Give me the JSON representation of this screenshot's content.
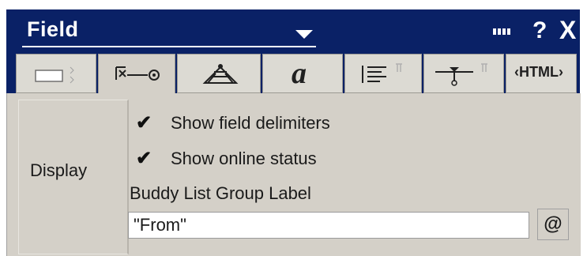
{
  "window": {
    "title": "Field",
    "help_label": "?",
    "close_label": "X"
  },
  "tabs": [
    {
      "name": "field-info",
      "icon": "field-box-icon"
    },
    {
      "name": "field-control",
      "icon": "field-key-icon",
      "active": true
    },
    {
      "name": "hide-when",
      "icon": "hat-icon"
    },
    {
      "name": "font",
      "icon": "font-a-icon",
      "label": "a"
    },
    {
      "name": "paragraph",
      "icon": "paragraph-align-icon"
    },
    {
      "name": "paragraph-hide",
      "icon": "paragraph-hide-icon"
    },
    {
      "name": "html",
      "icon": "html-tag-icon",
      "label": "‹HTML›"
    }
  ],
  "panel": {
    "section_label": "Display",
    "options": [
      {
        "label": "Show field delimiters",
        "checked": true
      },
      {
        "label": "Show online status",
        "checked": true
      }
    ],
    "buddy_label": "Buddy List Group Label",
    "buddy_value": "\"From\"",
    "formula_button_label": "@"
  }
}
